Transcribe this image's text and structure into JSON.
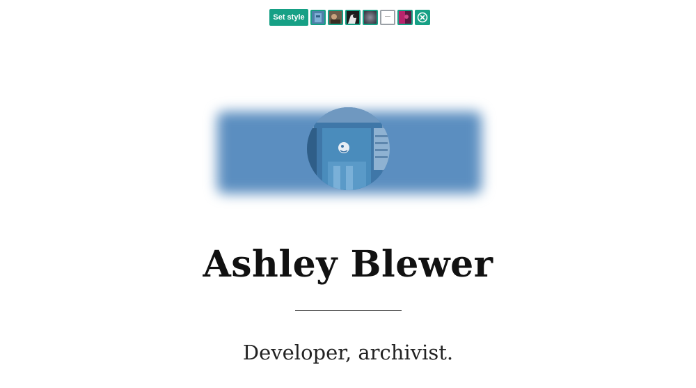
{
  "toolbar": {
    "set_style_label": "Set style",
    "accent_color": "#16a085",
    "swatches": [
      {
        "name": "style-swatch-1",
        "icon": "building-thumbnail"
      },
      {
        "name": "style-swatch-2",
        "icon": "portrait-thumbnail"
      },
      {
        "name": "style-swatch-3",
        "icon": "silhouette-thumbnail"
      },
      {
        "name": "style-swatch-4",
        "icon": "gradient-thumbnail"
      },
      {
        "name": "style-swatch-5",
        "icon": "blank-page-thumbnail",
        "active": true
      },
      {
        "name": "style-swatch-6",
        "icon": "magenta-photo-thumbnail"
      }
    ],
    "close_icon": "close-circle-icon"
  },
  "hero": {
    "band_color": "#5b8ec0",
    "avatar_icon": "profile-photo"
  },
  "profile": {
    "name": "Ashley Blewer",
    "tagline": "Developer, archivist."
  }
}
